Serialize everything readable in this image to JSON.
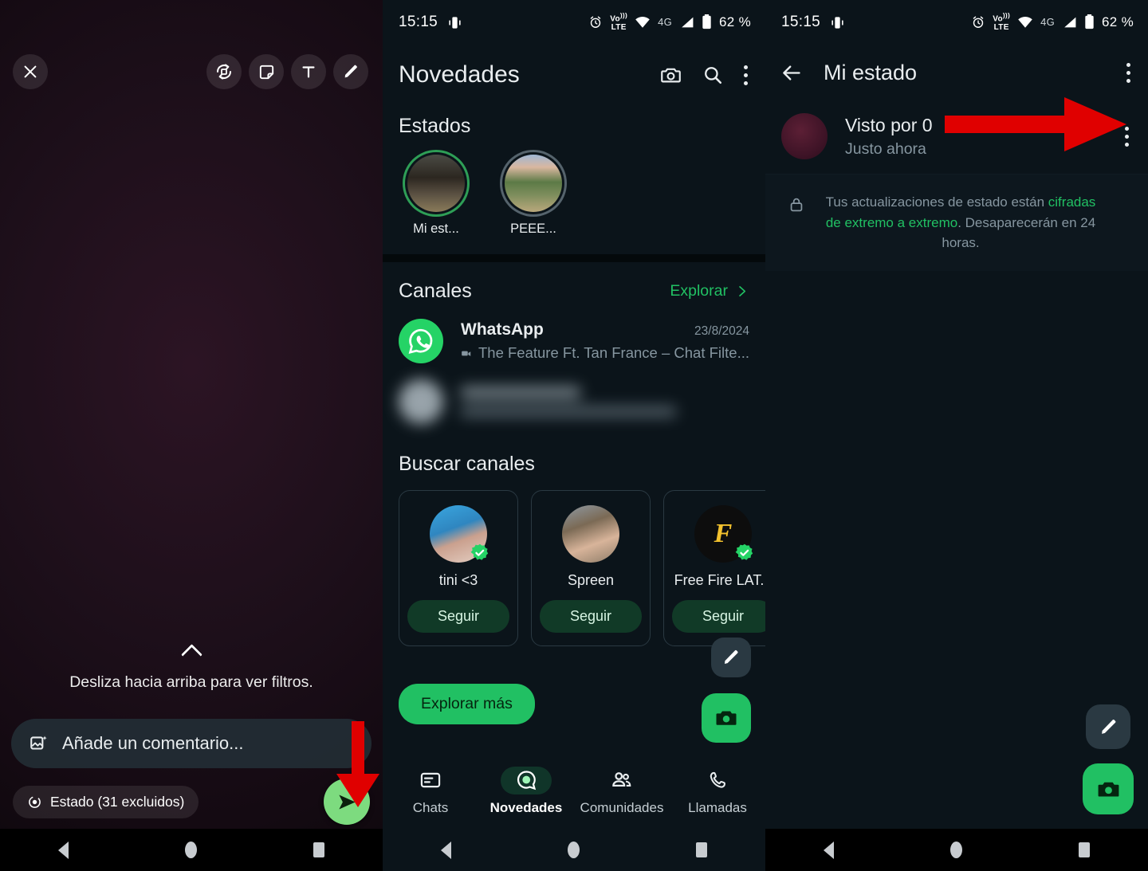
{
  "statusbar": {
    "time": "15:15",
    "battery": "62 %",
    "network": "4G",
    "volte": "VoLTE",
    "icons": [
      "vibrate-icon",
      "alarm-icon",
      "volte-icon",
      "wifi-icon",
      "signal-icon",
      "battery-icon"
    ]
  },
  "panel1": {
    "close_label": "✕",
    "tools": [
      "rotate-icon",
      "sticker-icon",
      "text-icon",
      "pencil-icon"
    ],
    "swipe_hint": "Desliza hacia arriba para ver filtros.",
    "comment_placeholder": "Añade un comentario...",
    "audience_label": "Estado (31 excluidos)",
    "send_label": "send-icon"
  },
  "panel2": {
    "title": "Novedades",
    "header_icons": [
      "camera-icon",
      "search-icon",
      "overflow-menu-icon"
    ],
    "status_section_title": "Estados",
    "statuses": [
      {
        "label": "Mi est...",
        "ring": "mine"
      },
      {
        "label": "PEEE...",
        "ring": "other"
      }
    ],
    "channels_section_title": "Canales",
    "explore_label": "Explorar",
    "channels": [
      {
        "name": "WhatsApp",
        "date": "23/8/2024",
        "preview": "The Feature Ft. Tan France – Chat Filte...",
        "blurred": false
      },
      {
        "name": "",
        "date": "",
        "preview": "",
        "blurred": true
      }
    ],
    "find_channels_title": "Buscar canales",
    "suggested": [
      {
        "name": "tini <3",
        "follow_label": "Seguir",
        "verified": true
      },
      {
        "name": "Spreen",
        "follow_label": "Seguir",
        "verified": false
      },
      {
        "name": "Free Fire LAT...",
        "follow_label": "Seguir",
        "verified": true
      }
    ],
    "explore_more_label": "Explorar más",
    "fab_pencil": "pencil-icon",
    "fab_camera": "camera-icon",
    "tabs": [
      {
        "label": "Chats",
        "icon": "chats-icon",
        "active": false
      },
      {
        "label": "Novedades",
        "icon": "status-icon",
        "active": true
      },
      {
        "label": "Comunidades",
        "icon": "communities-icon",
        "active": false
      },
      {
        "label": "Llamadas",
        "icon": "calls-icon",
        "active": false
      }
    ]
  },
  "panel3": {
    "back_label": "back-arrow-icon",
    "title": "Mi estado",
    "overflow_label": "overflow-menu-icon",
    "seen_title": "Visto por 0",
    "seen_sub": "Justo ahora",
    "encryption_prefix": "Tus actualizaciones de estado están ",
    "encryption_highlight": "cifradas de extremo a extremo",
    "encryption_suffix": ". Desaparecerán en 24 horas.",
    "fab_pencil": "pencil-icon",
    "fab_camera": "camera-icon"
  },
  "colors": {
    "accent_green": "#21c063",
    "bg_dark": "#0b141a",
    "arrow_red": "#e00000",
    "text_primary": "#e9edef",
    "text_secondary": "#8696a0"
  }
}
